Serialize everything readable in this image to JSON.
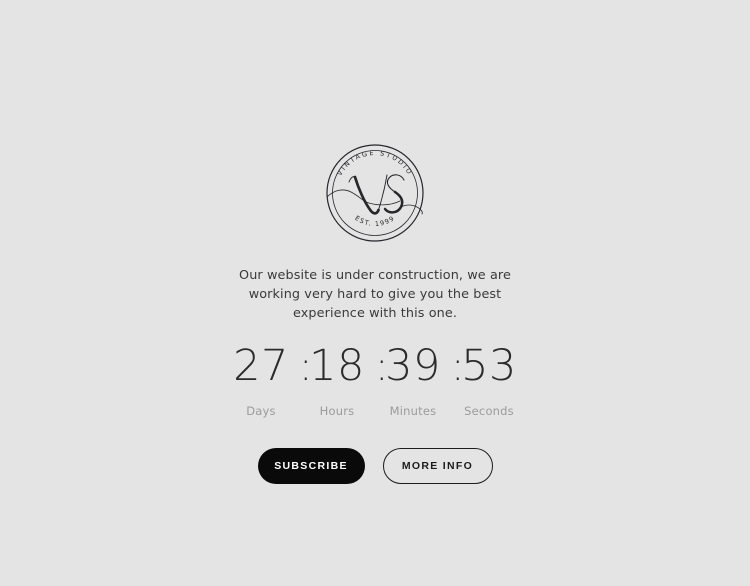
{
  "theme": {
    "background": "#e4e4e4",
    "text_dark": "#3a3a3a",
    "countdown_color": "#2b2b2b",
    "label_color": "#9b9b9b",
    "primary_button_bg": "#0a0a0a",
    "primary_button_text": "#ffffff",
    "secondary_button_border": "#1c1c1c",
    "logo_stroke": "#26262b"
  },
  "logo": {
    "name": "vintage-studio-badge",
    "top_text": "VINTAGE STUDIO",
    "monogram": "VS",
    "bottom_text": "EST. 1999"
  },
  "description": {
    "line1": "Our website is under construction, we are working very hard to give",
    "line2": "you the best experience with this one.",
    "full": "Our website is under construction, we are working very hard to give you the best experience with this one."
  },
  "countdown": {
    "separator": ":",
    "units": [
      {
        "value": "27",
        "label": "Days"
      },
      {
        "value": "18",
        "label": "Hours"
      },
      {
        "value": "39",
        "label": "Minutes"
      },
      {
        "value": "53",
        "label": "Seconds"
      }
    ]
  },
  "buttons": {
    "primary": "SUBSCRIBE",
    "secondary": "MORE INFO"
  }
}
